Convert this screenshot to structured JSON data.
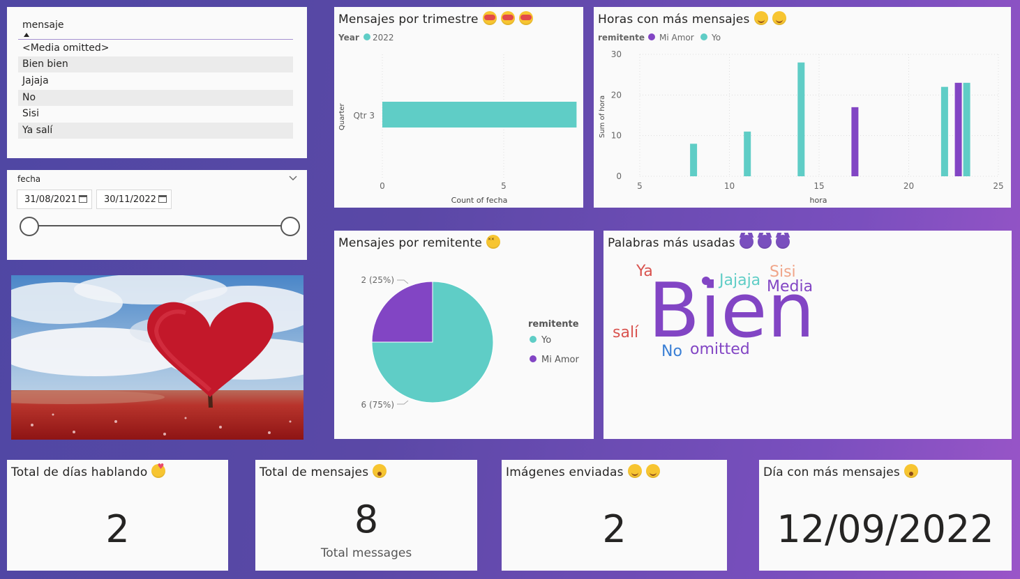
{
  "message_slicer": {
    "header": "mensaje",
    "items": [
      "<Media omitted>",
      "Bien bien",
      "Jajaja",
      "No",
      "Sisi",
      "Ya salí"
    ]
  },
  "date_slicer": {
    "label": "fecha",
    "start": "31/08/2021",
    "end": "30/11/2022"
  },
  "image": {
    "alt": "heart-shaped red tree in a field"
  },
  "quarter_chart": {
    "title": "Mensajes por trimestre",
    "legend_title": "Year",
    "legend_item": "2022",
    "ylabel": "Quarter",
    "xlabel": "Count of fecha",
    "category": "Qtr 3",
    "xticks": [
      "0",
      "5"
    ]
  },
  "hours_chart": {
    "title": "Horas con más mensajes",
    "legend_title": "remitente",
    "legend_items": [
      "Mi Amor",
      "Yo"
    ],
    "ylabel": "Sum of hora",
    "xlabel": "hora",
    "xticks": [
      "5",
      "10",
      "15",
      "20",
      "25"
    ],
    "yticks": [
      "0",
      "10",
      "20",
      "30"
    ]
  },
  "sender_chart": {
    "title": "Mensajes por remitente",
    "legend_title": "remitente",
    "legend_items": [
      "Yo",
      "Mi Amor"
    ],
    "label_small": "2 (25%)",
    "label_large": "6 (75%)"
  },
  "word_cloud": {
    "title": "Palabras más usadas",
    "words": [
      "Ya",
      "Jajaja",
      "Sisi",
      "Media",
      "Bien",
      "salí",
      "No",
      "omitted"
    ]
  },
  "kpis": {
    "days": {
      "title": "Total de días hablando",
      "value": "2"
    },
    "messages": {
      "title": "Total de mensajes",
      "value": "8",
      "caption": "Total messages"
    },
    "images": {
      "title": "Imágenes enviadas",
      "value": "2"
    },
    "top_day": {
      "title": "Día con más mensajes",
      "value": "12/09/2022"
    }
  },
  "colors": {
    "yo": "#5fcdc6",
    "mi_amor": "#8245c4",
    "accent": "#a48fd0"
  },
  "chart_data": [
    {
      "type": "bar",
      "orientation": "horizontal",
      "categories": [
        "Qtr 3"
      ],
      "series": [
        {
          "name": "2022",
          "values": [
            8
          ]
        }
      ],
      "title": "Mensajes por trimestre",
      "xlabel": "Count of fecha",
      "ylabel": "Quarter",
      "xlim": [
        0,
        8
      ]
    },
    {
      "type": "bar",
      "x": [
        8,
        11,
        14,
        17,
        22,
        23
      ],
      "series": [
        {
          "name": "Mi Amor",
          "values": [
            0,
            0,
            0,
            17,
            0,
            23
          ]
        },
        {
          "name": "Yo",
          "values": [
            8,
            11,
            28,
            0,
            22,
            23
          ]
        }
      ],
      "title": "Horas con más mensajes",
      "xlabel": "hora",
      "ylabel": "Sum of hora",
      "xlim": [
        5,
        25
      ],
      "ylim": [
        0,
        30
      ]
    },
    {
      "type": "pie",
      "categories": [
        "Yo",
        "Mi Amor"
      ],
      "values": [
        6,
        2
      ],
      "title": "Mensajes por remitente"
    }
  ]
}
